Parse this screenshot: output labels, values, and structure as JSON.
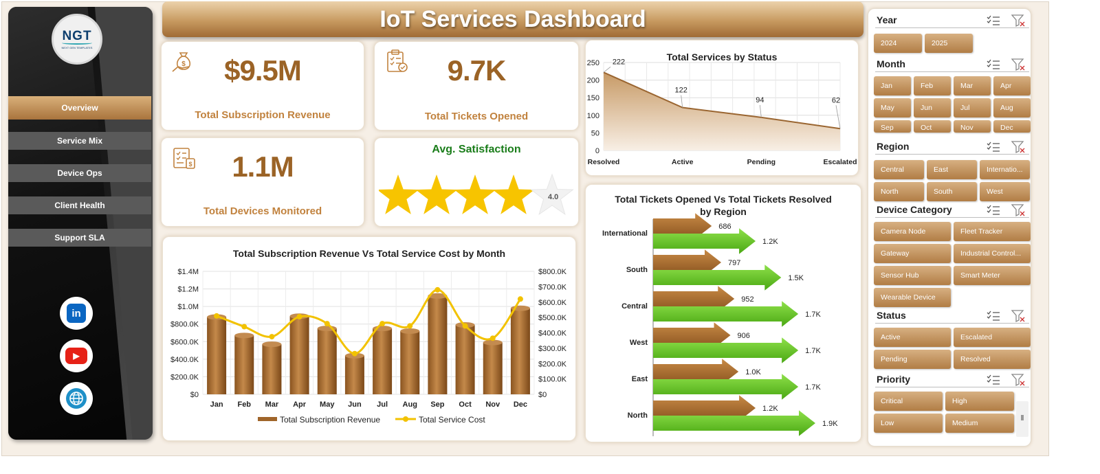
{
  "title": "IoT Services Dashboard",
  "logo": {
    "mark": "NGT",
    "sub": "NEXT GEN TEMPLATES"
  },
  "nav": [
    {
      "label": "Overview",
      "active": true
    },
    {
      "label": "Service Mix",
      "active": false
    },
    {
      "label": "Device Ops",
      "active": false
    },
    {
      "label": "Client Health",
      "active": false
    },
    {
      "label": "Support SLA",
      "active": false
    }
  ],
  "social": [
    {
      "name": "linkedin-icon",
      "glyph": "in",
      "color": "#0a66c2"
    },
    {
      "name": "youtube-icon",
      "glyph": "▶",
      "color": "#e62117"
    },
    {
      "name": "globe-icon",
      "glyph": "🌐",
      "color": "#1e90c8"
    }
  ],
  "kpis": {
    "revenue": {
      "value": "$9.5M",
      "label": "Total Subscription  Revenue"
    },
    "tickets": {
      "value": "9.7K",
      "label": "Total Tickets Opened"
    },
    "devices": {
      "value": "1.1M",
      "label": "Total Devices Monitored"
    },
    "satisfaction": {
      "label": "Avg. Satisfaction",
      "value_text": "4.0",
      "value": 4.0,
      "max": 5
    }
  },
  "colors": {
    "brown": "#9b6326",
    "gold": "#c1823e",
    "bar": "#a86a2a",
    "line": "#f2c200",
    "green": "#5fbf1f",
    "star": "#f7c400"
  },
  "chart_data": [
    {
      "type": "area",
      "title": "Total Services by Status",
      "categories": [
        "Resolved",
        "Active",
        "Pending",
        "Escalated"
      ],
      "values": [
        222,
        122,
        94,
        62
      ],
      "ylim": [
        0,
        250
      ],
      "yticks": [
        "0",
        "50",
        "100",
        "150",
        "200",
        "250"
      ],
      "grid": true
    },
    {
      "type": "bar",
      "title": "Total Subscription Revenue Vs Total Service Cost by Month",
      "categories": [
        "Jan",
        "Feb",
        "Mar",
        "Apr",
        "May",
        "Jun",
        "Jul",
        "Aug",
        "Sep",
        "Oct",
        "Nov",
        "Dec"
      ],
      "series": [
        {
          "name": "Total Subscription Revenue",
          "type": "bar",
          "axis": "left",
          "values": [
            880000,
            670000,
            570000,
            890000,
            750000,
            440000,
            750000,
            720000,
            1120000,
            790000,
            590000,
            980000
          ]
        },
        {
          "name": "Total Service Cost",
          "type": "line",
          "axis": "right",
          "values": [
            510000,
            440000,
            375000,
            505000,
            460000,
            265000,
            460000,
            445000,
            680000,
            445000,
            365000,
            620000
          ]
        }
      ],
      "ylim_left": [
        0,
        1400000
      ],
      "ylim_right": [
        0,
        800000
      ],
      "yticks_left": [
        "$0",
        "$200.0K",
        "$400.0K",
        "$600.0K",
        "$800.0K",
        "$1.0M",
        "$1.2M",
        "$1.4M"
      ],
      "yticks_right": [
        "$0",
        "$100.0K",
        "$200.0K",
        "$300.0K",
        "$400.0K",
        "$500.0K",
        "$600.0K",
        "$700.0K",
        "$800.0K"
      ],
      "legend": "bottom",
      "grid": true
    },
    {
      "type": "bar",
      "orientation": "horizontal",
      "title": "Total Tickets Opened Vs Total Tickets Resolved by Region",
      "categories": [
        "International",
        "South",
        "Central",
        "West",
        "East",
        "North"
      ],
      "series": [
        {
          "name": "Total Tickets Opened",
          "values": [
            686,
            797,
            952,
            906,
            1000,
            1200
          ],
          "labels": [
            "686",
            "797",
            "952",
            "906",
            "1.0K",
            "1.2K"
          ]
        },
        {
          "name": "Total Tickets Resolved",
          "values": [
            1200,
            1500,
            1700,
            1700,
            1700,
            1900
          ],
          "labels": [
            "1.2K",
            "1.5K",
            "1.7K",
            "1.7K",
            "1.7K",
            "1.9K"
          ]
        }
      ]
    }
  ],
  "slicers": [
    {
      "title": "Year",
      "items": [
        "2024",
        "2025"
      ]
    },
    {
      "title": "Month",
      "items": [
        "Jan",
        "Feb",
        "Mar",
        "Apr",
        "May",
        "Jun",
        "Jul",
        "Aug",
        "Sep",
        "Oct",
        "Nov",
        "Dec"
      ]
    },
    {
      "title": "Region",
      "items": [
        "Central",
        "East",
        "Internatio...",
        "North",
        "South",
        "West"
      ]
    },
    {
      "title": "Device Category",
      "items": [
        "Camera Node",
        "Fleet Tracker",
        "Gateway",
        "Industrial Control...",
        "Sensor Hub",
        "Smart Meter",
        "Wearable Device"
      ]
    },
    {
      "title": "Status",
      "items": [
        "Active",
        "Escalated",
        "Pending",
        "Resolved"
      ]
    },
    {
      "title": "Priority",
      "items": [
        "Critical",
        "High",
        "Low",
        "Medium"
      ]
    }
  ]
}
